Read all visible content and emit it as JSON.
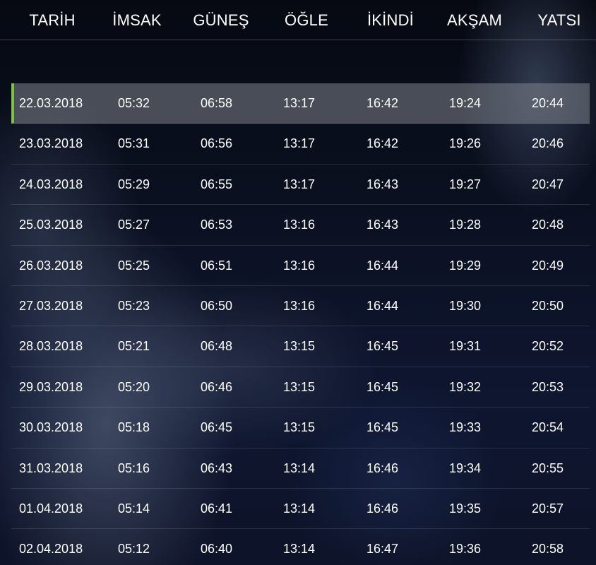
{
  "headers": [
    "TARİH",
    "İMSAK",
    "GÜNEŞ",
    "ÖĞLE",
    "İKİNDİ",
    "AKŞAM",
    "YATSI"
  ],
  "rows": [
    [
      "22.03.2018",
      "05:32",
      "06:58",
      "13:17",
      "16:42",
      "19:24",
      "20:44"
    ],
    [
      "23.03.2018",
      "05:31",
      "06:56",
      "13:17",
      "16:42",
      "19:26",
      "20:46"
    ],
    [
      "24.03.2018",
      "05:29",
      "06:55",
      "13:17",
      "16:43",
      "19:27",
      "20:47"
    ],
    [
      "25.03.2018",
      "05:27",
      "06:53",
      "13:16",
      "16:43",
      "19:28",
      "20:48"
    ],
    [
      "26.03.2018",
      "05:25",
      "06:51",
      "13:16",
      "16:44",
      "19:29",
      "20:49"
    ],
    [
      "27.03.2018",
      "05:23",
      "06:50",
      "13:16",
      "16:44",
      "19:30",
      "20:50"
    ],
    [
      "28.03.2018",
      "05:21",
      "06:48",
      "13:15",
      "16:45",
      "19:31",
      "20:52"
    ],
    [
      "29.03.2018",
      "05:20",
      "06:46",
      "13:15",
      "16:45",
      "19:32",
      "20:53"
    ],
    [
      "30.03.2018",
      "05:18",
      "06:45",
      "13:15",
      "16:45",
      "19:33",
      "20:54"
    ],
    [
      "31.03.2018",
      "05:16",
      "06:43",
      "13:14",
      "16:46",
      "19:34",
      "20:55"
    ],
    [
      "01.04.2018",
      "05:14",
      "06:41",
      "13:14",
      "16:46",
      "19:35",
      "20:57"
    ],
    [
      "02.04.2018",
      "05:12",
      "06:40",
      "13:14",
      "16:47",
      "19:36",
      "20:58"
    ]
  ],
  "active_row": 0,
  "colors": {
    "accent": "#7cc245",
    "highlight": "#80848c",
    "text": "#ffffff"
  }
}
